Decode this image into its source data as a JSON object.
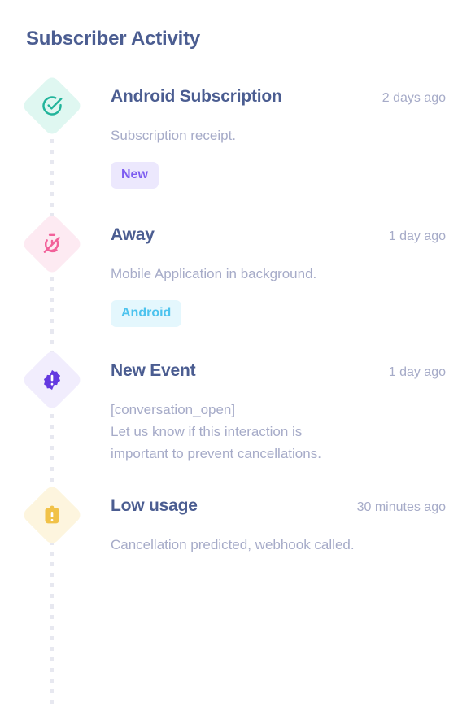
{
  "panel": {
    "title": "Subscriber Activity",
    "background": "#ffffff",
    "title_color": "#4b5d91",
    "rail_color": "#e7e8f0"
  },
  "items": [
    {
      "icon": "check-circle-icon",
      "icon_color": "#22b49b",
      "diamond_color": "#dff7f1",
      "title": "Android Subscription",
      "time": "2 days ago",
      "description": "Subscription receipt.",
      "tags": [
        {
          "label": "New",
          "text_color": "#7c5cf0",
          "bg_color": "#ece8fd"
        }
      ]
    },
    {
      "icon": "timer-off-icon",
      "icon_color": "#f2619a",
      "diamond_color": "#fdeaf2",
      "title": "Away",
      "time": "1 day ago",
      "description": "Mobile Application in background.",
      "tags": [
        {
          "label": "Android",
          "text_color": "#4cc3ee",
          "bg_color": "#e4f7fd"
        }
      ]
    },
    {
      "icon": "alert-badge-icon",
      "icon_color": "#6439e0",
      "diamond_color": "#f1edfd",
      "title": "New Event",
      "time": "1 day ago",
      "description": "[conversation_open]\nLet us know if this interaction is\nimportant to prevent cancellations.",
      "tags": []
    },
    {
      "icon": "clipboard-alert-icon",
      "icon_color": "#f1c248",
      "diamond_color": "#fdf5de",
      "title": "Low usage",
      "time": "30 minutes ago",
      "description": "Cancellation predicted, webhook called.",
      "tags": []
    }
  ]
}
